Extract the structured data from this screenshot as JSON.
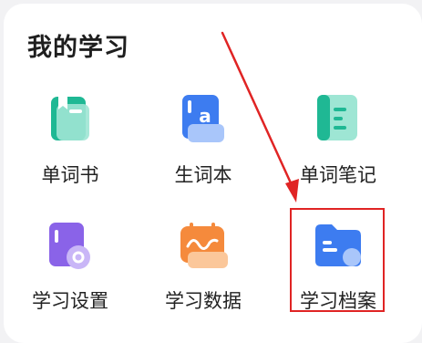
{
  "section": {
    "title": "我的学习"
  },
  "tiles": [
    {
      "label": "单词书",
      "icon": "book-icon",
      "color": "#2dc5a4"
    },
    {
      "label": "生词本",
      "icon": "vocab-notebook-icon",
      "color": "#3d7cf0"
    },
    {
      "label": "单词笔记",
      "icon": "word-notes-icon",
      "color": "#2dc5a4"
    },
    {
      "label": "学习设置",
      "icon": "study-settings-icon",
      "color": "#8a63e8"
    },
    {
      "label": "学习数据",
      "icon": "study-data-icon",
      "color": "#f58a3c"
    },
    {
      "label": "学习档案",
      "icon": "study-archive-icon",
      "color": "#3d7cf0"
    }
  ],
  "annotation": {
    "color": "#e02424",
    "target": "学习档案"
  }
}
